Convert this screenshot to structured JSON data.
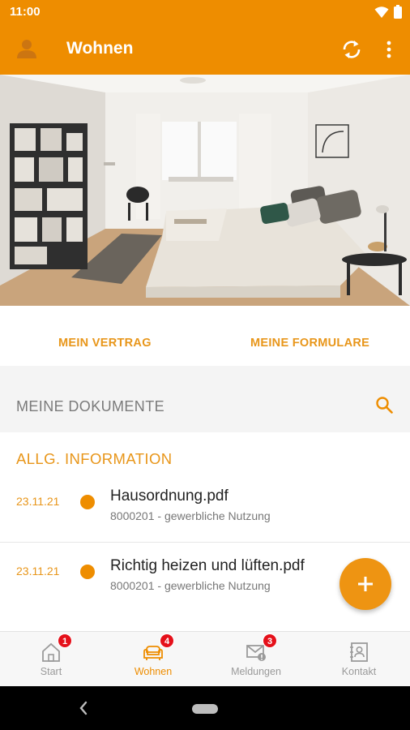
{
  "status_bar": {
    "time": "11:00",
    "icons": [
      "wifi-icon",
      "battery-icon"
    ]
  },
  "app_bar": {
    "title": "Wohnen",
    "icons": [
      "user-avatar-icon",
      "sync-icon",
      "more-vert-icon"
    ]
  },
  "colors": {
    "primary": "#ee8d00",
    "accent_text": "#e8961a",
    "badge": "#e5101a",
    "inactive": "#9a9a9a"
  },
  "links": {
    "contract": "MEIN VERTRAG",
    "forms": "MEINE FORMULARE"
  },
  "documents": {
    "header": "MEINE DOKUMENTE",
    "section_title": "ALLG. INFORMATION",
    "items": [
      {
        "date": "23.11.21",
        "name": "Hausordnung.pdf",
        "meta": "8000201 - gewerbliche Nutzung"
      },
      {
        "date": "23.11.21",
        "name": "Richtig heizen und lüften.pdf",
        "meta": "8000201 - gewerbliche Nutzung"
      }
    ]
  },
  "fab": {
    "icon": "plus-icon"
  },
  "bottom_nav": {
    "items": [
      {
        "label": "Start",
        "badge": "1",
        "icon": "home-icon",
        "active": false
      },
      {
        "label": "Wohnen",
        "badge": "4",
        "icon": "sofa-icon",
        "active": true
      },
      {
        "label": "Meldungen",
        "badge": "3",
        "icon": "mail-alert-icon",
        "active": false
      },
      {
        "label": "Kontakt",
        "badge": "",
        "icon": "contact-book-icon",
        "active": false
      }
    ]
  }
}
